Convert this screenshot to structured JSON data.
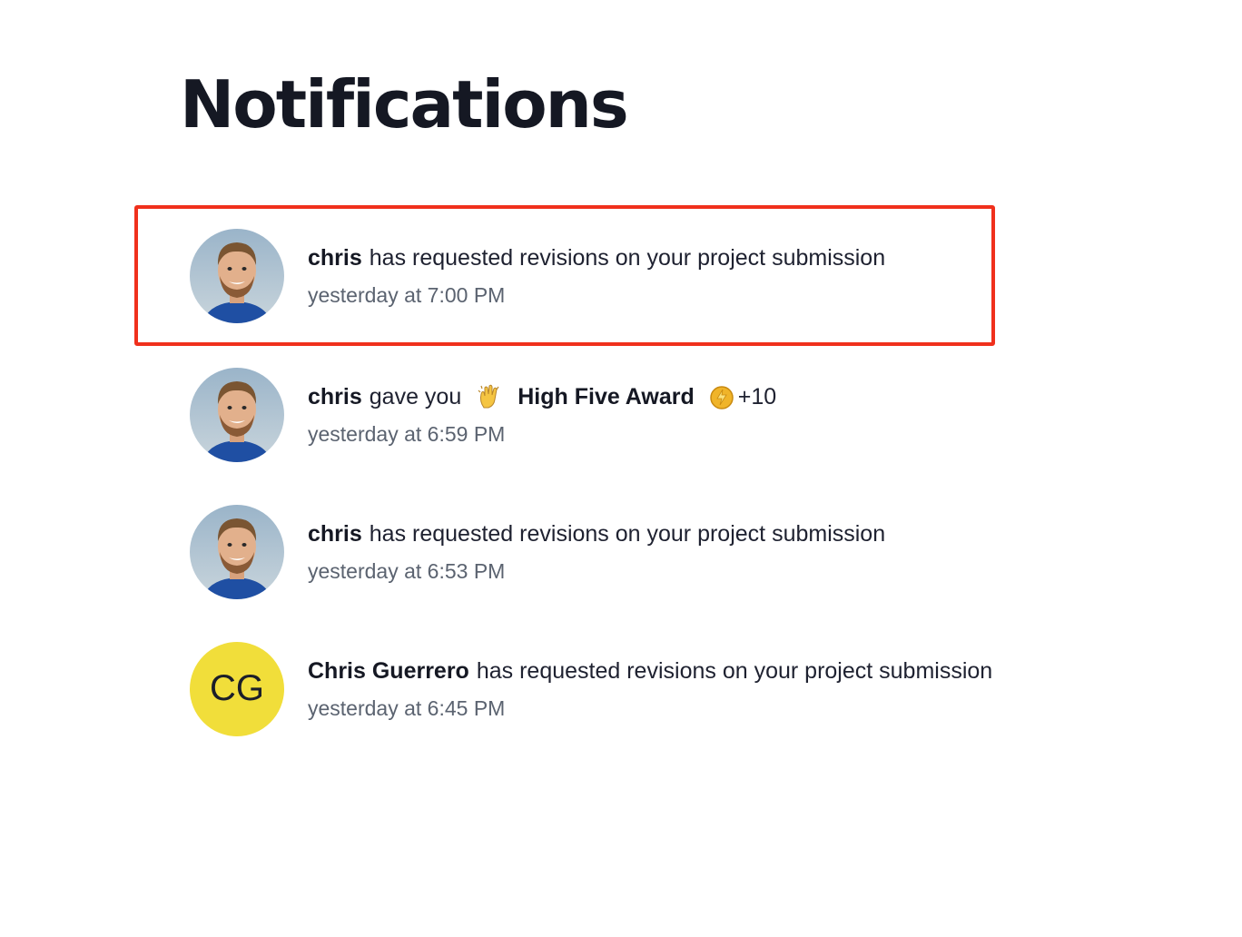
{
  "page": {
    "title": "Notifications"
  },
  "notifications": [
    {
      "actor": "chris",
      "message": "has requested revisions on your project submission",
      "time": "yesterday at 7:00 PM",
      "avatar": "photo",
      "highlighted": true
    },
    {
      "actor": "chris",
      "message": "gave you",
      "award_icon": "clapping-hands-icon",
      "award_name": "High Five Award",
      "coin_icon": "coin-icon",
      "points": "+10",
      "time": "yesterday at 6:59 PM",
      "avatar": "photo"
    },
    {
      "actor": "chris",
      "message": "has requested revisions on your project submission",
      "time": "yesterday at 6:53 PM",
      "avatar": "photo"
    },
    {
      "actor": "Chris Guerrero",
      "message": "has requested revisions on your project submission",
      "time": "yesterday at 6:45 PM",
      "avatar": "initials",
      "avatar_initials": "CG",
      "avatar_color": "#f1de3a"
    }
  ],
  "colors": {
    "highlight_border": "#f0301c",
    "time_text": "#5b6370"
  }
}
